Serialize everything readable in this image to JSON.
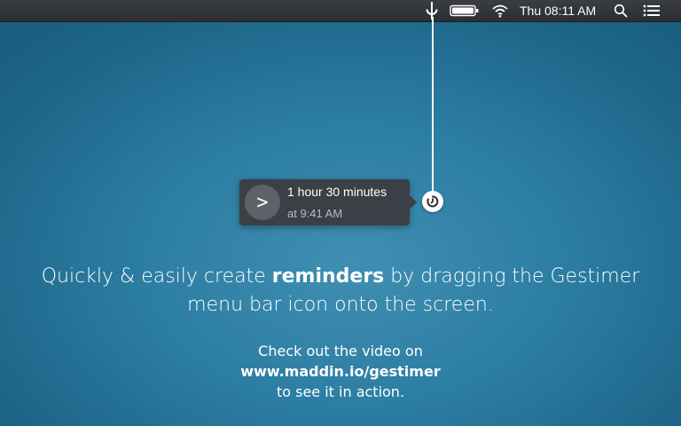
{
  "menubar": {
    "clock": "Thu 08:11 AM",
    "icons": [
      "gestimer-icon",
      "battery-icon",
      "wifi-icon",
      "spotlight-search-icon",
      "notification-center-icon"
    ]
  },
  "reminder": {
    "title": "1 hour 30 minutes",
    "time": "at 9:41 AM",
    "circle_glyph": ">"
  },
  "headline": {
    "before": "Quickly & easily create ",
    "bold": "reminders",
    "after": " by dragging the Gestimer",
    "line2": "menu bar icon onto the screen."
  },
  "promo": {
    "line1": "Check out the video on",
    "link": "www.maddin.io/gestimer",
    "line3": "to see it in action."
  }
}
